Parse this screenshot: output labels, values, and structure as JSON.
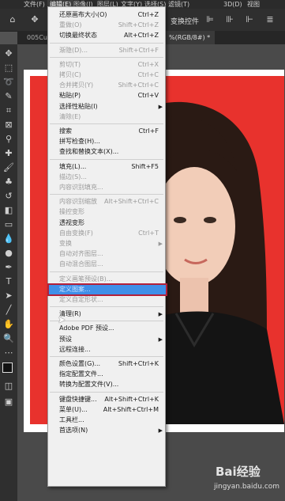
{
  "menubar": {
    "items": [
      "文件(F)",
      "编辑(E)",
      "图像(I)",
      "图层(L)",
      "文字(Y)",
      "选择(S)",
      "滤镜(T)",
      "3D(D)",
      "视图"
    ]
  },
  "options": {
    "transform_label": "变换控件"
  },
  "tabs": [
    "005Cul",
    "%(RGB/8#) *"
  ],
  "menu": {
    "items": [
      {
        "label": "还原画布大小(O)",
        "shortcut": "Ctrl+Z",
        "disabled": false
      },
      {
        "label": "重做(O)",
        "shortcut": "Shift+Ctrl+Z",
        "disabled": true
      },
      {
        "label": "切换最终状态",
        "shortcut": "Alt+Ctrl+Z",
        "disabled": false
      },
      {
        "sep": true
      },
      {
        "label": "渐隐(D)...",
        "shortcut": "Shift+Ctrl+F",
        "disabled": true
      },
      {
        "sep": true
      },
      {
        "label": "剪切(T)",
        "shortcut": "Ctrl+X",
        "disabled": true
      },
      {
        "label": "拷贝(C)",
        "shortcut": "Ctrl+C",
        "disabled": true
      },
      {
        "label": "合并拷贝(Y)",
        "shortcut": "Shift+Ctrl+C",
        "disabled": true
      },
      {
        "label": "粘贴(P)",
        "shortcut": "Ctrl+V",
        "disabled": false
      },
      {
        "label": "选择性粘贴(I)",
        "shortcut": "",
        "disabled": false,
        "submenu": true
      },
      {
        "label": "清除(E)",
        "shortcut": "",
        "disabled": true
      },
      {
        "sep": true
      },
      {
        "label": "搜索",
        "shortcut": "Ctrl+F",
        "disabled": false
      },
      {
        "label": "拼写检查(H)...",
        "shortcut": "",
        "disabled": false
      },
      {
        "label": "查找和替换文本(X)...",
        "shortcut": "",
        "disabled": false
      },
      {
        "sep": true
      },
      {
        "label": "填充(L)...",
        "shortcut": "Shift+F5",
        "disabled": false
      },
      {
        "label": "描边(S)...",
        "shortcut": "",
        "disabled": true
      },
      {
        "label": "内容识别填充...",
        "shortcut": "",
        "disabled": true
      },
      {
        "sep": true
      },
      {
        "label": "内容识别缩放",
        "shortcut": "Alt+Shift+Ctrl+C",
        "disabled": true
      },
      {
        "label": "操控变形",
        "shortcut": "",
        "disabled": true
      },
      {
        "label": "透视变形",
        "shortcut": "",
        "disabled": false
      },
      {
        "label": "自由变换(F)",
        "shortcut": "Ctrl+T",
        "disabled": true
      },
      {
        "label": "变换",
        "shortcut": "",
        "disabled": true,
        "submenu": true
      },
      {
        "label": "自动对齐图层...",
        "shortcut": "",
        "disabled": true
      },
      {
        "label": "自动混合图层...",
        "shortcut": "",
        "disabled": true
      },
      {
        "sep": true
      },
      {
        "label": "定义画笔预设(B)...",
        "shortcut": "",
        "disabled": true
      },
      {
        "label": "定义图案...",
        "shortcut": "",
        "disabled": false,
        "highlight": true
      },
      {
        "label": "定义自定形状...",
        "shortcut": "",
        "disabled": true
      },
      {
        "sep": true
      },
      {
        "label": "清理(R)",
        "shortcut": "",
        "disabled": false,
        "submenu": true
      },
      {
        "sep": true
      },
      {
        "label": "Adobe PDF 预设...",
        "shortcut": "",
        "disabled": false
      },
      {
        "label": "预设",
        "shortcut": "",
        "disabled": false,
        "submenu": true
      },
      {
        "label": "远程连接...",
        "shortcut": "",
        "disabled": false
      },
      {
        "sep": true
      },
      {
        "label": "颜色设置(G)...",
        "shortcut": "Shift+Ctrl+K",
        "disabled": false
      },
      {
        "label": "指定配置文件...",
        "shortcut": "",
        "disabled": false
      },
      {
        "label": "转换为配置文件(V)...",
        "shortcut": "",
        "disabled": false
      },
      {
        "sep": true
      },
      {
        "label": "键盘快捷键...",
        "shortcut": "Alt+Shift+Ctrl+K",
        "disabled": false
      },
      {
        "label": "菜单(U)...",
        "shortcut": "Alt+Shift+Ctrl+M",
        "disabled": false
      },
      {
        "label": "工具栏...",
        "shortcut": "",
        "disabled": false
      },
      {
        "label": "首选项(N)",
        "shortcut": "",
        "disabled": false,
        "submenu": true
      }
    ]
  },
  "watermark": {
    "brand": "Bai经验",
    "url": "jingyan.baidu.com"
  },
  "colors": {
    "accent": "#3f8fe8",
    "highlight_border": "#b3213a",
    "photo_bg": "#e8322d"
  }
}
